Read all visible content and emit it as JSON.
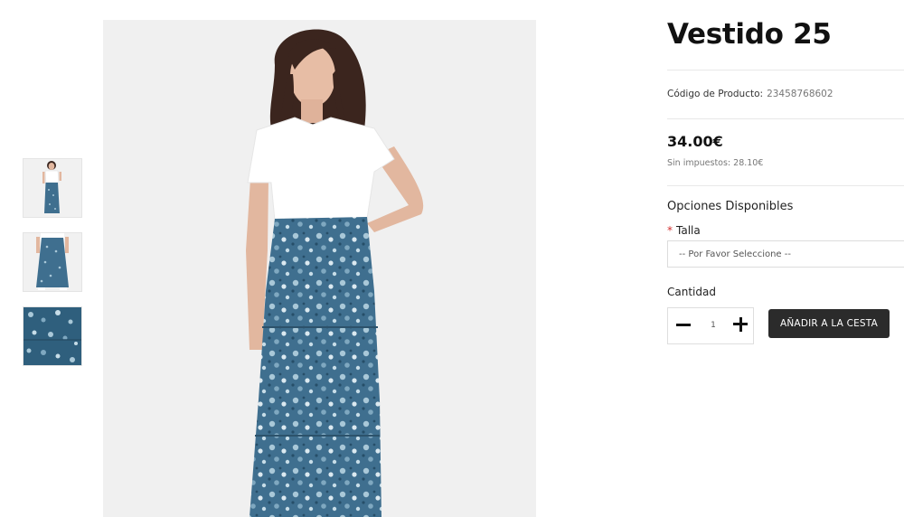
{
  "product": {
    "title": "Vestido 25",
    "code_label": "Código de Producto:",
    "code_value": "23458768602",
    "price": "34.00€",
    "tax_text": "Sin impuestos: 28.10€"
  },
  "options": {
    "heading": "Opciones Disponibles",
    "size_label": "Talla",
    "required_marker": "*",
    "size_placeholder": "-- Por Favor Seleccione --"
  },
  "quantity": {
    "label": "Cantidad",
    "value": "1"
  },
  "actions": {
    "add_to_cart": "AÑADIR A LA CESTA"
  },
  "colors": {
    "skirt": "#3f6f8f",
    "button": "#2b2b2b",
    "required": "#d32f2f"
  }
}
